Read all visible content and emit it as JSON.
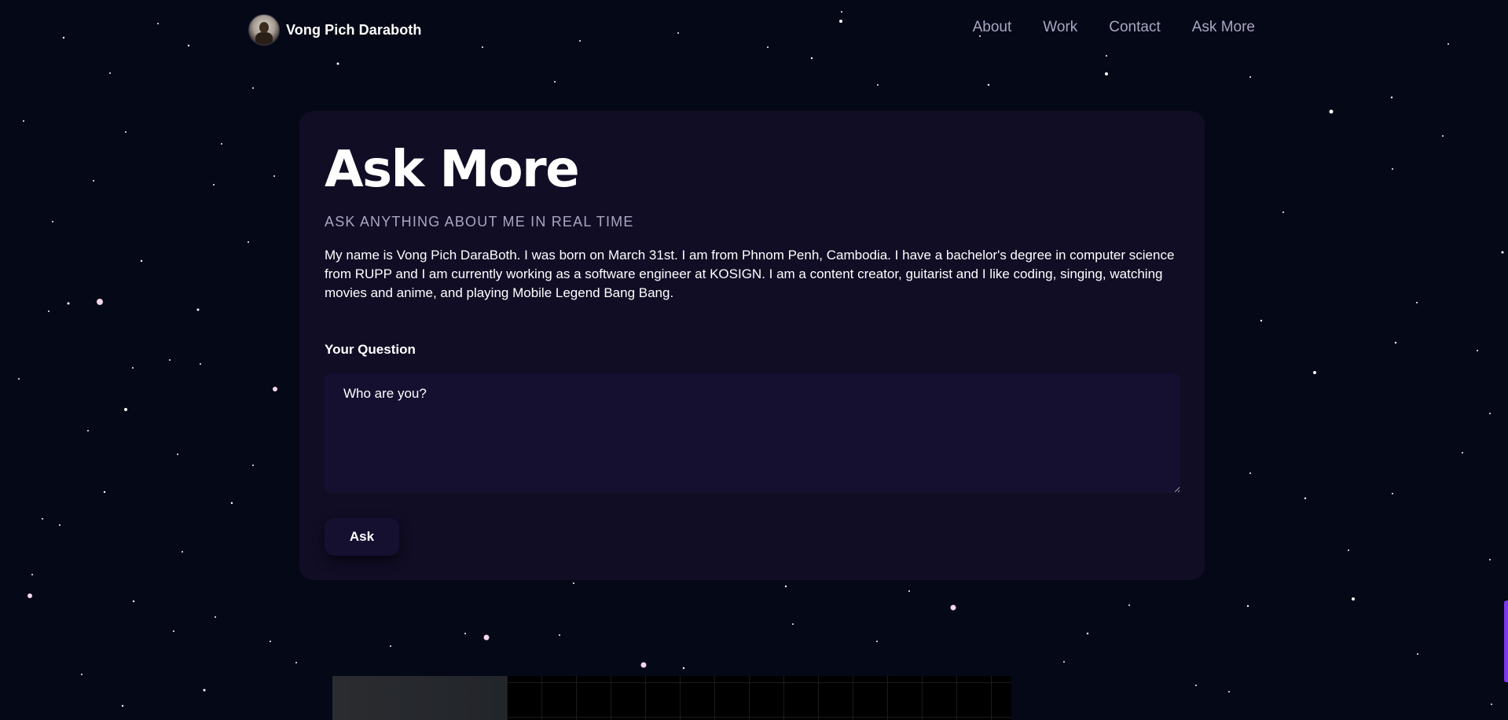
{
  "header": {
    "brand_name": "Vong Pich Daraboth",
    "nav": [
      {
        "label": "About"
      },
      {
        "label": "Work"
      },
      {
        "label": "Contact"
      },
      {
        "label": "Ask More"
      }
    ]
  },
  "section": {
    "title": "Ask More",
    "subtitle": "ASK ANYTHING ABOUT ME IN REAL TIME",
    "intro": "My name is Vong Pich DaraBoth. I was born on March 31st. I am from Phnom Penh, Cambodia. I have a bachelor's degree in computer science from RUPP and I am currently working as a software engineer at KOSIGN. I am a content creator, guitarist and I like coding, singing, watching movies and anime, and playing Mobile Legend Bang Bang.",
    "question_label": "Your Question",
    "question_value": "Who are you?",
    "ask_button": "Ask"
  },
  "colors": {
    "background": "#050816",
    "card": "#100d25",
    "input": "#151030",
    "secondary_text": "#aaa6c3",
    "accent": "#7c3aed"
  }
}
